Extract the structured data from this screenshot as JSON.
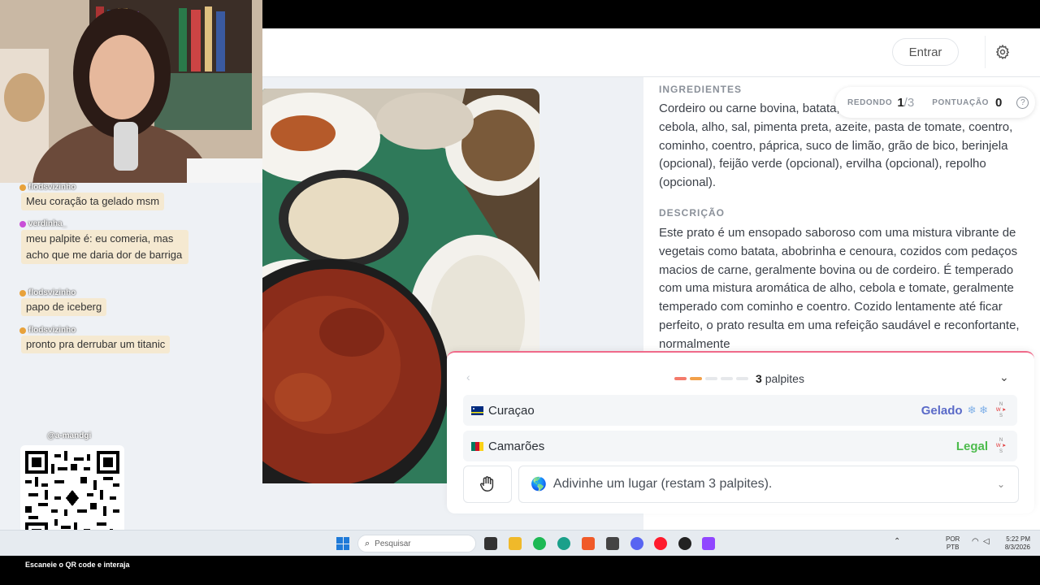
{
  "header": {
    "login_label": "Entrar"
  },
  "score": {
    "round_label": "REDONDO",
    "round_current": "1",
    "round_total": "/3",
    "points_label": "PONTUAÇÃO",
    "points": "0"
  },
  "info": {
    "ingredients_title": "INGREDIENTES",
    "ingredients_text": "Cordeiro ou carne bovina, batata, abobrinha, cenoura, pimentão, cebola, alho, sal, pimenta preta, azeite, pasta de tomate, coentro, cominho, coentro, páprica, suco de limão, grão de bico, berinjela (opcional), feijão verde (opcional), ervilha (opcional), repolho (opcional).",
    "description_title": "DESCRIÇÃO",
    "description_text": "Este prato é um ensopado saboroso com uma mistura vibrante de vegetais como batata, abobrinha e cenoura, cozidos com pedaços macios de carne, geralmente bovina ou de cordeiro. É temperado com uma mistura aromática de alho, cebola e tomate, geralmente temperado com cominho e coentro. Cozido lentamente até ficar perfeito, o prato resulta em uma refeição saudável e reconfortante, normalmente"
  },
  "guess_panel": {
    "count": "3",
    "count_label": "palpites",
    "dots_colors": [
      "#f47a6b",
      "#f2a04a",
      "#e6e8eb",
      "#e6e8eb",
      "#e6e8eb"
    ],
    "guesses": [
      {
        "country": "Curaçao",
        "result": "Gelado",
        "result_color": "#5a6ac8",
        "extra": "❄ ❄"
      },
      {
        "country": "Camarões",
        "result": "Legal",
        "result_color": "#4cbb4c",
        "extra": ""
      }
    ],
    "input_placeholder": "Adivinhe um lugar (restam 3 palpites)."
  },
  "chat": [
    {
      "user": "flodsvizinho",
      "badge_color": "#e8a23b",
      "message": "Meu coração ta gelado msm"
    },
    {
      "user": "verdinha_",
      "badge_color": "#c94fd8",
      "message": "meu palpite é: eu comeria, mas acho que me daria dor de barriga"
    },
    {
      "user": "flodsvizinho",
      "badge_color": "#e8a23b",
      "message": "papo de iceberg"
    },
    {
      "user": "flodsvizinho",
      "badge_color": "#e8a23b",
      "message": "pronto pra derrubar um titanic"
    }
  ],
  "qr": {
    "handle": "@a-mandgi",
    "caption": "Escaneie o QR code e interaja"
  },
  "taskbar": {
    "search_placeholder": "Pesquisar",
    "lang_line1": "POR",
    "lang_line2": "PTB",
    "time": "5:22 PM",
    "date": "8/3/2026"
  }
}
